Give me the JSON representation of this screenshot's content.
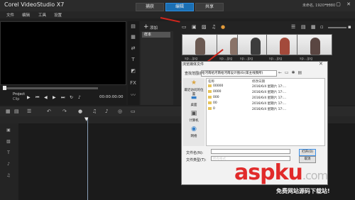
{
  "app": {
    "title": "Corel VideoStudio X7",
    "tabs": [
      "捕获",
      "编辑",
      "共享"
    ],
    "active_tab": "编辑",
    "meta": "未命名, 1920*1080",
    "window_controls": "— ▢ ✕"
  },
  "menu": {
    "items": [
      "文件",
      "编辑",
      "工具",
      "设置"
    ]
  },
  "preview": {
    "project_label": "Project",
    "clip_label": "Clip",
    "timecode": "00:00:00:00"
  },
  "library": {
    "folder": "样本",
    "add_symbol": "+",
    "add_label": "添加",
    "thumbnails": [
      {
        "caption": "sp...jpg"
      },
      {
        "caption": "sp...jpg"
      },
      {
        "caption": "sp...jpg"
      },
      {
        "caption": "sp...jpg"
      },
      {
        "caption": "sp...jpg"
      }
    ]
  },
  "dialog": {
    "title": "浏览媒体文件",
    "lookin_label": "查找范围(I):",
    "path": "给河南给河南给河南设计图(6)(第主线我所)",
    "col_name": "名称",
    "col_date": "修改日期",
    "places": [
      "最近访问的位置",
      "桌面",
      "计算机",
      "网络"
    ],
    "files": [
      {
        "name": "00000",
        "date": "2016/6/4 星期六 17:..."
      },
      {
        "name": "0000",
        "date": "2016/6/4 星期六 17:..."
      },
      {
        "name": "000",
        "date": "2016/6/4 星期六 17:..."
      },
      {
        "name": "00",
        "date": "2016/6/4 星期六 17:..."
      },
      {
        "name": "0",
        "date": "2016/6/4 星期六 17:..."
      }
    ],
    "filename_label": "文件名(N):",
    "filetype_label": "文件类型(T):",
    "filetype_value": "所有格式",
    "open_label": "打开(O)",
    "cancel_label": "取消",
    "close_symbol": "✕"
  },
  "watermark": {
    "brand": "aspku",
    "tld": ".com",
    "subtitle": "免费网站源码下载站!"
  },
  "colors": {
    "accent": "#1b6fb3",
    "annotation_red": "#d0261d"
  }
}
